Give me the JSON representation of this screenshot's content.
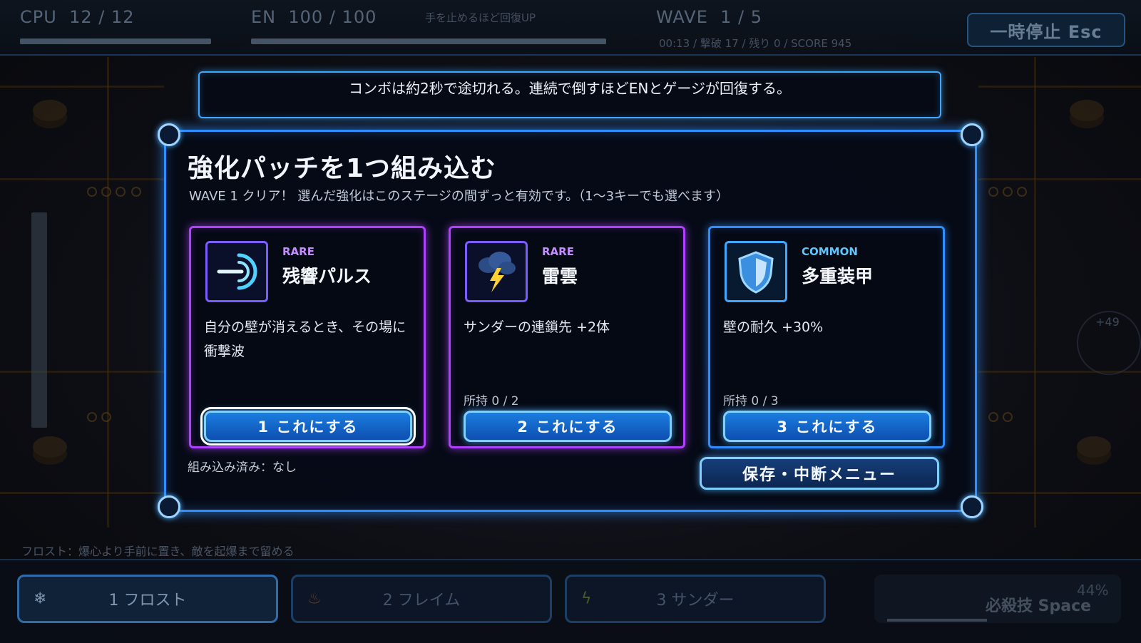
{
  "hud": {
    "cpu_label": "CPU",
    "cpu_value": "12 / 12",
    "cpu_fill": 1.0,
    "en_label": "EN",
    "en_value": "100 / 100",
    "en_fill": 1.0,
    "en_note": "手を止めるほど回復UP",
    "wave_label": "WAVE",
    "wave_value": "1 / 5",
    "stats": "00:13 / 撃破 17 / 残り 0 / SCORE 945",
    "pause_label": "一時停止 Esc"
  },
  "tip": "コンボは約2秒で途切れる。連続で倒すほどENとゲージが回復する。",
  "panel": {
    "title": "強化パッチを1つ組み込む",
    "subtitle": "WAVE 1 クリア！ 選んだ強化はこのステージの間ずっと有効です。（1〜3キーでも選べます）",
    "installed": "組み込み済み：なし",
    "save_label": "保存・中断メニュー"
  },
  "cards": [
    {
      "rarity": "RARE",
      "name": "残響パルス",
      "desc": "自分の壁が消えるとき、その場に衝撃波",
      "owned": "",
      "button": "1 これにする",
      "icon": "pulse-icon"
    },
    {
      "rarity": "RARE",
      "name": "雷雲",
      "desc": "サンダーの連鎖先 +2体",
      "owned": "所持 0 / 2",
      "button": "2 これにする",
      "icon": "thundercloud-icon"
    },
    {
      "rarity": "COMMON",
      "name": "多重装甲",
      "desc": "壁の耐久 +30%",
      "owned": "所持 0 / 3",
      "button": "3 これにする",
      "icon": "shield-icon"
    }
  ],
  "side": {
    "gauge_value": "+49"
  },
  "bottom": {
    "hint": "フロスト：爆心より手前に置き、敵を起爆まで留める",
    "skills": [
      {
        "label": "1 フロスト",
        "icon": "snowflake-icon"
      },
      {
        "label": "2 フレイム",
        "icon": "flame-icon"
      },
      {
        "label": "3 サンダー",
        "icon": "lightning-icon"
      }
    ],
    "ult_label": "必殺技 Space",
    "ult_pct": "44%"
  },
  "colors": {
    "rare": "#b040ff",
    "common": "#2f8dff",
    "button": "#1b7de0",
    "background": "#0d0e14"
  }
}
